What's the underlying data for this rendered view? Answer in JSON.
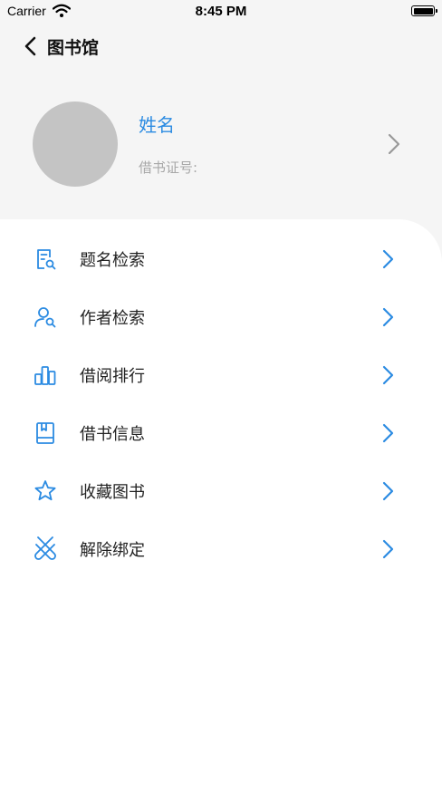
{
  "status_bar": {
    "carrier": "Carrier",
    "time": "8:45 PM"
  },
  "nav": {
    "title": "图书馆",
    "back_icon": "chevron-left-icon"
  },
  "profile": {
    "name": "姓名",
    "card_label": "借书证号:",
    "avatar_icon": "avatar-placeholder"
  },
  "colors": {
    "accent": "#2b8be2",
    "icon": "#2b8be2",
    "background": "#f5f5f5",
    "panel": "#ffffff"
  },
  "menu": [
    {
      "label": "题名检索",
      "icon": "document-search-icon"
    },
    {
      "label": "作者检索",
      "icon": "person-search-icon"
    },
    {
      "label": "借阅排行",
      "icon": "bar-chart-icon"
    },
    {
      "label": "借书信息",
      "icon": "book-icon"
    },
    {
      "label": "收藏图书",
      "icon": "star-icon"
    },
    {
      "label": "解除绑定",
      "icon": "unlink-icon"
    }
  ]
}
